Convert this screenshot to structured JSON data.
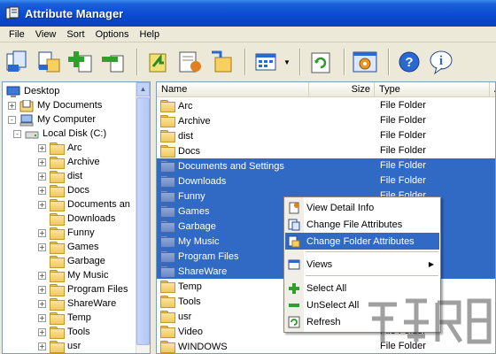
{
  "window": {
    "title": "Attribute Manager"
  },
  "menu": [
    "File",
    "View",
    "Sort",
    "Options",
    "Help"
  ],
  "toolbar": {
    "buttons": [
      "copy-attributes-icon",
      "paste-attributes-icon",
      "add-icon",
      "remove-icon",
      "back-icon",
      "edit-icon",
      "export-icon",
      "view-icon",
      "refresh-icon",
      "settings-icon",
      "help-icon",
      "info-icon"
    ]
  },
  "tree": {
    "items": [
      {
        "label": "Desktop",
        "level": 0,
        "expander": "",
        "icon": "desktop-icon"
      },
      {
        "label": "My Documents",
        "level": 1,
        "expander": "+",
        "icon": "documents-icon"
      },
      {
        "label": "My Computer",
        "level": 1,
        "expander": "-",
        "icon": "computer-icon"
      },
      {
        "label": "Local Disk (C:)",
        "level": 2,
        "expander": "-",
        "icon": "drive-icon"
      },
      {
        "label": "Arc",
        "level": 3,
        "expander": "+",
        "icon": "folder-icon"
      },
      {
        "label": "Archive",
        "level": 3,
        "expander": "+",
        "icon": "folder-icon"
      },
      {
        "label": "dist",
        "level": 3,
        "expander": "+",
        "icon": "folder-icon"
      },
      {
        "label": "Docs",
        "level": 3,
        "expander": "+",
        "icon": "folder-icon"
      },
      {
        "label": "Documents an",
        "level": 3,
        "expander": "+",
        "icon": "folder-icon"
      },
      {
        "label": "Downloads",
        "level": 3,
        "expander": "",
        "icon": "folder-icon"
      },
      {
        "label": "Funny",
        "level": 3,
        "expander": "+",
        "icon": "folder-icon"
      },
      {
        "label": "Games",
        "level": 3,
        "expander": "+",
        "icon": "folder-icon"
      },
      {
        "label": "Garbage",
        "level": 3,
        "expander": "",
        "icon": "folder-icon"
      },
      {
        "label": "My Music",
        "level": 3,
        "expander": "+",
        "icon": "folder-icon"
      },
      {
        "label": "Program Files",
        "level": 3,
        "expander": "+",
        "icon": "folder-icon"
      },
      {
        "label": "ShareWare",
        "level": 3,
        "expander": "+",
        "icon": "folder-icon"
      },
      {
        "label": "Temp",
        "level": 3,
        "expander": "+",
        "icon": "folder-icon"
      },
      {
        "label": "Tools",
        "level": 3,
        "expander": "+",
        "icon": "folder-icon"
      },
      {
        "label": "usr",
        "level": 3,
        "expander": "+",
        "icon": "folder-icon"
      }
    ]
  },
  "list": {
    "columns": [
      "Name",
      "Size",
      "Type",
      "A"
    ],
    "rows": [
      {
        "name": "Arc",
        "type": "File Folder",
        "selected": false
      },
      {
        "name": "Archive",
        "type": "File Folder",
        "selected": false
      },
      {
        "name": "dist",
        "type": "File Folder",
        "selected": false
      },
      {
        "name": "Docs",
        "type": "File Folder",
        "selected": false
      },
      {
        "name": "Documents and Settings",
        "type": "File Folder",
        "selected": true
      },
      {
        "name": "Downloads",
        "type": "File Folder",
        "selected": true
      },
      {
        "name": "Funny",
        "type": "File Folder",
        "selected": true
      },
      {
        "name": "Games",
        "type": "",
        "selected": true
      },
      {
        "name": "Garbage",
        "type": "",
        "selected": true
      },
      {
        "name": "My Music",
        "type": "",
        "selected": true
      },
      {
        "name": "Program Files",
        "type": "",
        "selected": true
      },
      {
        "name": "ShareWare",
        "type": "",
        "selected": true
      },
      {
        "name": "Temp",
        "type": "",
        "selected": false
      },
      {
        "name": "Tools",
        "type": "",
        "selected": false
      },
      {
        "name": "usr",
        "type": "",
        "selected": false
      },
      {
        "name": "Video",
        "type": "File Folder",
        "selected": false
      },
      {
        "name": "WINDOWS",
        "type": "File Folder",
        "selected": false
      }
    ]
  },
  "context_menu": {
    "items": [
      {
        "label": "View Detail Info",
        "icon": "detail-info-icon",
        "highlight": false
      },
      {
        "label": "Change File Attributes",
        "icon": "file-attributes-icon",
        "highlight": false
      },
      {
        "label": "Change Folder Attributes",
        "icon": "folder-attributes-icon",
        "highlight": true
      },
      {
        "label": "Views",
        "icon": "views-icon",
        "highlight": false,
        "submenu": true
      },
      {
        "label": "Select All",
        "icon": "select-all-icon",
        "highlight": false
      },
      {
        "label": "UnSelect All",
        "icon": "unselect-all-icon",
        "highlight": false
      },
      {
        "label": "Refresh",
        "icon": "refresh-icon",
        "highlight": false
      }
    ]
  },
  "colors": {
    "selection": "#316ac5",
    "titlebar": "#0a4ad0"
  }
}
